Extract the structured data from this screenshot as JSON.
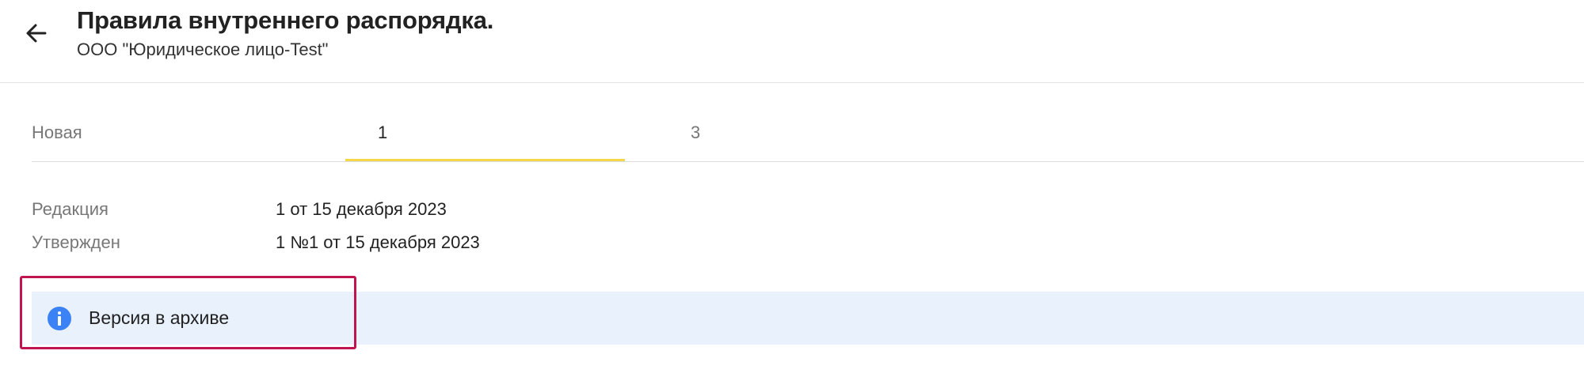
{
  "header": {
    "title": "Правила внутреннего распорядка.",
    "subtitle": "ООО \"Юридическое лицо-Test\"",
    "back_icon": "arrow-left-icon"
  },
  "tabs": [
    {
      "label": "Новая",
      "active": false
    },
    {
      "label": "1",
      "active": true
    },
    {
      "label": "3",
      "active": false
    }
  ],
  "details": {
    "edition_label": "Редакция",
    "edition_value": "1 от 15 декабря 2023",
    "approved_label": "Утвержден",
    "approved_value": "1 №1 от 15 декабря 2023"
  },
  "notice": {
    "icon": "info-icon",
    "text": "Версия в архиве"
  },
  "colors": {
    "accent_underline": "#f5d84a",
    "info_background": "#e8f1fc",
    "info_icon": "#3b82f6",
    "highlight_border": "#c0144f"
  }
}
